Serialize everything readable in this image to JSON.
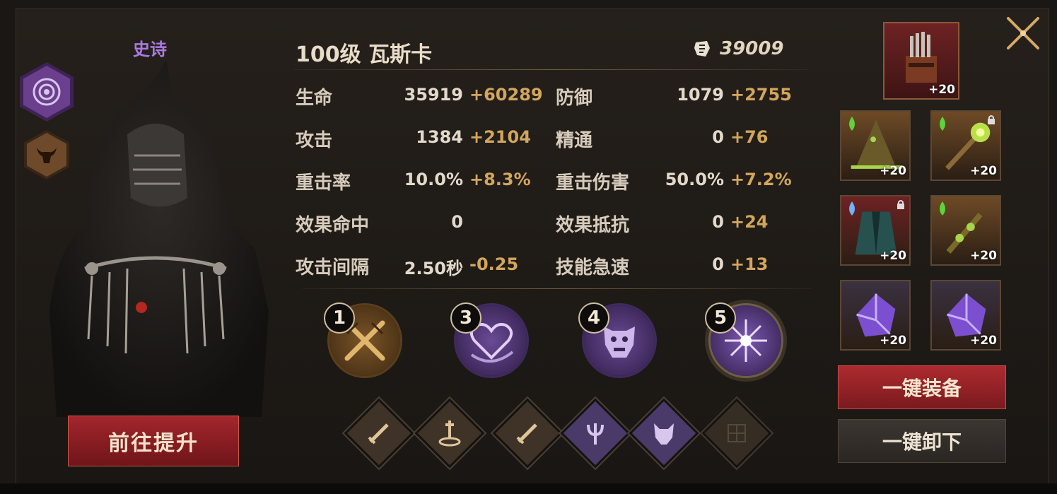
{
  "hero": {
    "rarity": "史诗",
    "name": "100级  瓦斯卡",
    "power": "39009"
  },
  "stats": [
    {
      "label": "生命",
      "base": "35919",
      "bonus": "+60289"
    },
    {
      "label": "防御",
      "base": "1079",
      "bonus": "+2755"
    },
    {
      "label": "攻击",
      "base": "1384",
      "bonus": "+2104"
    },
    {
      "label": "精通",
      "base": "0",
      "bonus": "+76"
    },
    {
      "label": "重击率",
      "base": "10.0%",
      "bonus": "+8.3%"
    },
    {
      "label": "重击伤害",
      "base": "50.0%",
      "bonus": "+7.2%"
    },
    {
      "label": "效果命中",
      "base": "0",
      "bonus": ""
    },
    {
      "label": "效果抵抗",
      "base": "0",
      "bonus": "+24"
    },
    {
      "label": "攻击间隔",
      "base": "2.50秒",
      "bonus": "-0.25"
    },
    {
      "label": "技能急速",
      "base": "0",
      "bonus": "+13"
    }
  ],
  "skills": [
    {
      "num": "1",
      "icon": "crossed-swords-icon"
    },
    {
      "num": "3",
      "icon": "heart-icon"
    },
    {
      "num": "4",
      "icon": "demon-mask-icon"
    },
    {
      "num": "5",
      "icon": "starburst-icon"
    }
  ],
  "traits": [
    "sword-icon",
    "altar-icon",
    "sword-icon",
    "trident-icon",
    "demon-head-icon",
    "empty-slot-icon"
  ],
  "gear": {
    "main": {
      "level": "+20",
      "icon": "organ-relic-icon"
    },
    "slots": [
      {
        "level": "+20",
        "icon": "hat-icon",
        "locked": false
      },
      {
        "level": "+20",
        "icon": "staff-icon",
        "locked": true
      },
      {
        "level": "+20",
        "icon": "robe-icon",
        "locked": true
      },
      {
        "level": "+20",
        "icon": "wand-icon",
        "locked": false
      },
      {
        "level": "+20",
        "icon": "purple-crystal-icon",
        "locked": false
      },
      {
        "level": "+20",
        "icon": "purple-crystal-icon",
        "locked": false
      }
    ]
  },
  "buttons": {
    "promote": "前往提升",
    "equip_all": "一键装备",
    "unequip_all": "一键卸下"
  },
  "colors": {
    "rarity_epic": "#a97be0",
    "bonus_gold": "#d2a65c",
    "button_red": "#a3262c"
  }
}
